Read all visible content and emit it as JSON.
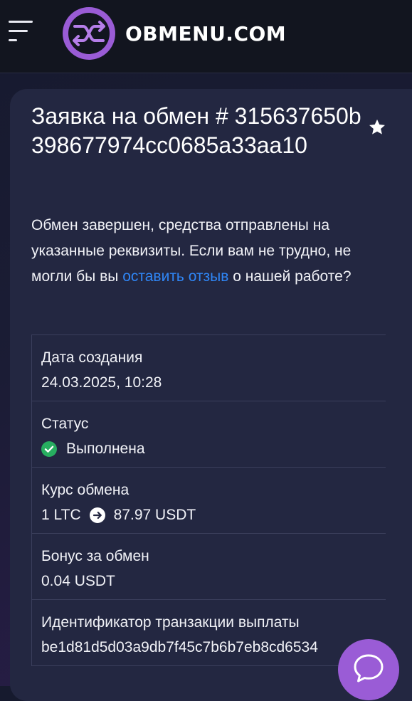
{
  "header": {
    "logo_text": "OBMENU.COM"
  },
  "order": {
    "title_prefix": "Заявка на обмен #",
    "order_id": "315637650b398677974cc0685a33aa10",
    "message_before": "Обмен завершен, средства отправлены на указанные реквизиты. Если вам не трудно, не могли бы вы ",
    "review_link": "оставить отзыв",
    "message_after": " о нашей работе?"
  },
  "details": {
    "created_label": "Дата создания",
    "created_value": "24.03.2025, 10:28",
    "status_label": "Статус",
    "status_value": "Выполнена",
    "rate_label": "Курс обмена",
    "rate_from": "1 LTC",
    "rate_to": "87.97 USDT",
    "bonus_label": "Бонус за обмен",
    "bonus_value": "0.04 USDT",
    "txid_label": "Идентификатор транзакции выплаты",
    "txid_value": "be1d81d5d03a9db7f45c7b6b7eb8cd6534"
  },
  "colors": {
    "accent": "#9a5cd6",
    "link": "#2f86f6",
    "success": "#27ae60"
  },
  "icons": {
    "menu": "hamburger-icon",
    "logo": "exchange-arrows-logo-icon",
    "favorite": "star-icon",
    "status": "check-circle-icon",
    "rate": "arrow-right-circle-icon",
    "chat": "chat-bubble-icon"
  }
}
